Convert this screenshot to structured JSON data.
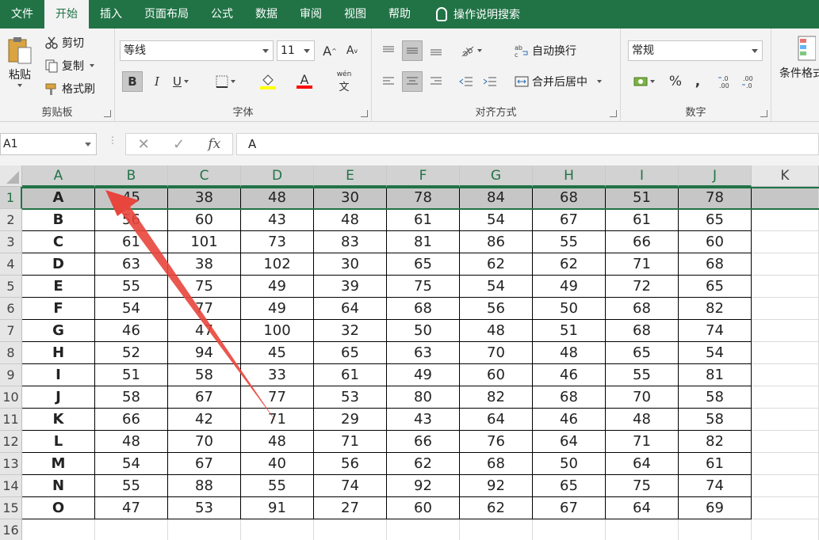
{
  "ribbon_tabs": [
    "文件",
    "开始",
    "插入",
    "页面布局",
    "公式",
    "数据",
    "审阅",
    "视图",
    "帮助"
  ],
  "active_tab": "开始",
  "tell_me": "操作说明搜索",
  "clipboard": {
    "paste": "粘贴",
    "cut": "剪切",
    "copy": "复制",
    "format_painter": "格式刷",
    "label": "剪贴板"
  },
  "font": {
    "name": "等线",
    "size": "11",
    "bold": "B",
    "italic": "I",
    "underline": "U",
    "font_color_glyph": "A",
    "phonetic": "wén",
    "grow": "A",
    "shrink": "A",
    "label": "字体",
    "highlight_color": "#ffff00",
    "font_color": "#ff0000"
  },
  "alignment": {
    "wrap_text": "自动换行",
    "merge_center": "合并后居中",
    "label": "对齐方式"
  },
  "number": {
    "format": "常规",
    "percent": "%",
    "comma": ",",
    "label": "数字"
  },
  "styles": {
    "conditional_formatting": "条件格式"
  },
  "formula_bar": {
    "name_box": "A1",
    "value": "A"
  },
  "grid": {
    "columns": [
      "A",
      "B",
      "C",
      "D",
      "E",
      "F",
      "G",
      "H",
      "I",
      "J",
      "K"
    ],
    "selected_row": 1,
    "rows": [
      {
        "n": "1",
        "cells": [
          "A",
          "45",
          "38",
          "48",
          "30",
          "78",
          "84",
          "68",
          "51",
          "78"
        ]
      },
      {
        "n": "2",
        "cells": [
          "B",
          "56",
          "60",
          "43",
          "48",
          "61",
          "54",
          "67",
          "61",
          "65"
        ]
      },
      {
        "n": "3",
        "cells": [
          "C",
          "61",
          "101",
          "73",
          "83",
          "81",
          "86",
          "55",
          "66",
          "60"
        ]
      },
      {
        "n": "4",
        "cells": [
          "D",
          "63",
          "38",
          "102",
          "30",
          "65",
          "62",
          "62",
          "71",
          "68"
        ]
      },
      {
        "n": "5",
        "cells": [
          "E",
          "55",
          "75",
          "49",
          "39",
          "75",
          "54",
          "49",
          "72",
          "65"
        ]
      },
      {
        "n": "6",
        "cells": [
          "F",
          "54",
          "77",
          "49",
          "64",
          "68",
          "56",
          "50",
          "68",
          "82"
        ]
      },
      {
        "n": "7",
        "cells": [
          "G",
          "46",
          "47",
          "100",
          "32",
          "50",
          "48",
          "51",
          "68",
          "74"
        ]
      },
      {
        "n": "8",
        "cells": [
          "H",
          "52",
          "94",
          "45",
          "65",
          "63",
          "70",
          "48",
          "65",
          "54"
        ]
      },
      {
        "n": "9",
        "cells": [
          "I",
          "51",
          "58",
          "33",
          "61",
          "49",
          "60",
          "46",
          "55",
          "81"
        ]
      },
      {
        "n": "10",
        "cells": [
          "J",
          "58",
          "67",
          "77",
          "53",
          "80",
          "82",
          "68",
          "70",
          "58"
        ]
      },
      {
        "n": "11",
        "cells": [
          "K",
          "66",
          "42",
          "71",
          "29",
          "43",
          "64",
          "46",
          "48",
          "58"
        ]
      },
      {
        "n": "12",
        "cells": [
          "L",
          "48",
          "70",
          "48",
          "71",
          "66",
          "76",
          "64",
          "71",
          "82"
        ]
      },
      {
        "n": "13",
        "cells": [
          "M",
          "54",
          "67",
          "40",
          "56",
          "62",
          "68",
          "50",
          "64",
          "61"
        ]
      },
      {
        "n": "14",
        "cells": [
          "N",
          "55",
          "88",
          "55",
          "74",
          "92",
          "92",
          "65",
          "75",
          "74"
        ]
      },
      {
        "n": "15",
        "cells": [
          "O",
          "47",
          "53",
          "91",
          "27",
          "60",
          "62",
          "67",
          "64",
          "69"
        ]
      },
      {
        "n": "16",
        "cells": [
          "",
          "",
          "",
          "",
          "",
          "",
          "",
          "",
          "",
          ""
        ]
      }
    ]
  },
  "colors": {
    "excel_green": "#217346",
    "annotation_arrow": "#e8453c"
  }
}
